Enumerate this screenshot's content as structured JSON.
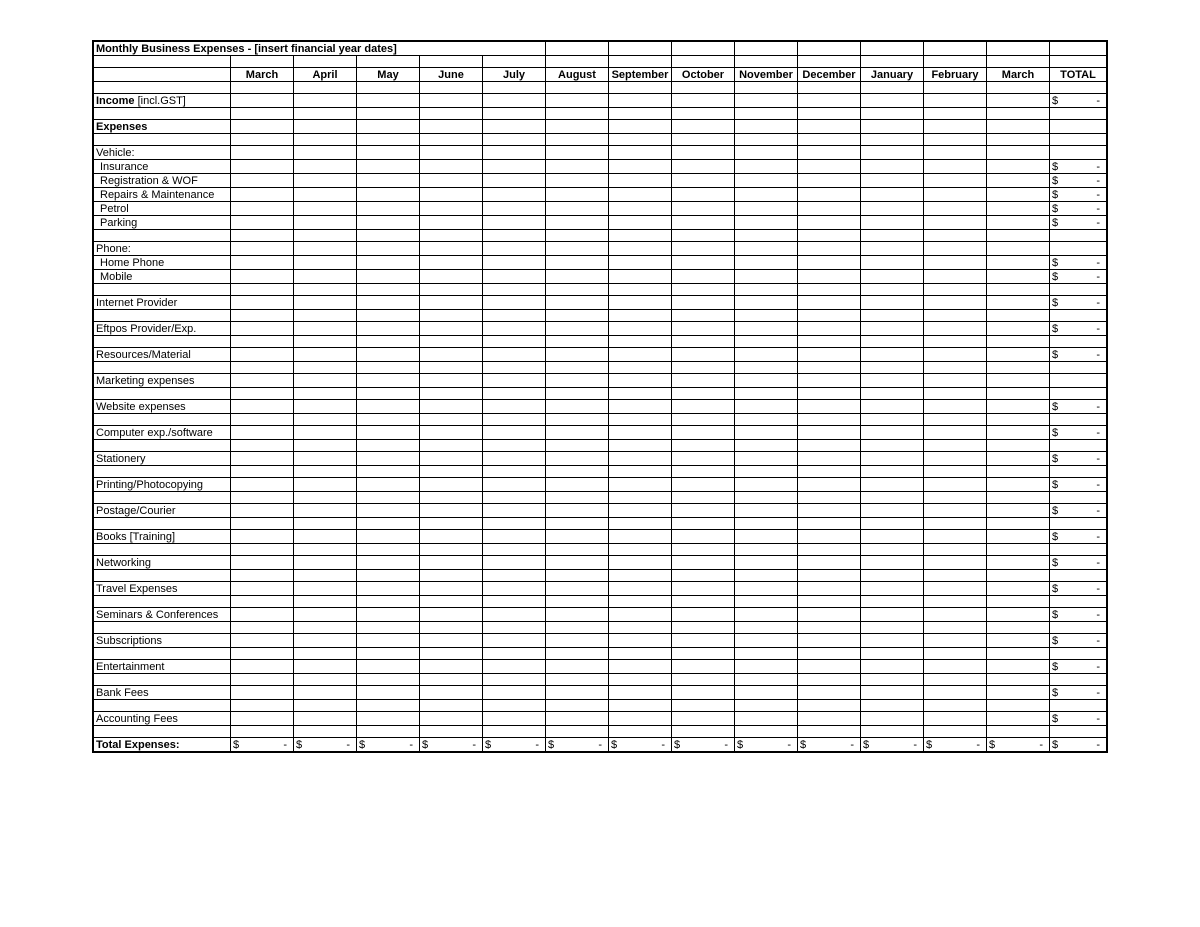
{
  "title": "Monthly Business Expenses - [insert financial year dates]",
  "months": [
    "March",
    "April",
    "May",
    "June",
    "July",
    "August",
    "September",
    "October",
    "November",
    "December",
    "January",
    "February",
    "March"
  ],
  "totalHeader": "TOTAL",
  "incomeLabelBold": "Income",
  "incomeLabelRest": " [incl.GST]",
  "expensesHeader": "Expenses",
  "currency": "$",
  "dash": "-",
  "totalsRowLabel": "Total Expenses:",
  "rows": [
    {
      "type": "spacer"
    },
    {
      "type": "category",
      "label": "Vehicle:"
    },
    {
      "type": "item",
      "label": "Insurance",
      "total": true
    },
    {
      "type": "item",
      "label": "Registration & WOF",
      "total": true
    },
    {
      "type": "item",
      "label": "Repairs & Maintenance",
      "total": true
    },
    {
      "type": "item",
      "label": "Petrol",
      "total": true
    },
    {
      "type": "item",
      "label": "Parking",
      "total": true
    },
    {
      "type": "spacer"
    },
    {
      "type": "category",
      "label": "Phone:"
    },
    {
      "type": "item",
      "label": "Home Phone",
      "total": true
    },
    {
      "type": "item",
      "label": "Mobile",
      "total": true
    },
    {
      "type": "spacer"
    },
    {
      "type": "category",
      "label": "Internet Provider",
      "total": true
    },
    {
      "type": "spacer"
    },
    {
      "type": "category",
      "label": "Eftpos Provider/Exp.",
      "total": true
    },
    {
      "type": "spacer"
    },
    {
      "type": "category",
      "label": "Resources/Material",
      "total": true
    },
    {
      "type": "spacer"
    },
    {
      "type": "category",
      "label": "Marketing expenses"
    },
    {
      "type": "spacer"
    },
    {
      "type": "category",
      "label": "Website expenses",
      "total": true
    },
    {
      "type": "spacer"
    },
    {
      "type": "category",
      "label": "Computer exp./software",
      "total": true
    },
    {
      "type": "spacer"
    },
    {
      "type": "category",
      "label": "Stationery",
      "total": true
    },
    {
      "type": "spacer"
    },
    {
      "type": "category",
      "label": "Printing/Photocopying",
      "total": true
    },
    {
      "type": "spacer"
    },
    {
      "type": "category",
      "label": "Postage/Courier",
      "total": true
    },
    {
      "type": "spacer"
    },
    {
      "type": "category",
      "label": "Books [Training]",
      "total": true
    },
    {
      "type": "spacer"
    },
    {
      "type": "category",
      "label": "Networking",
      "total": true
    },
    {
      "type": "spacer"
    },
    {
      "type": "category",
      "label": "Travel Expenses",
      "total": true
    },
    {
      "type": "spacer"
    },
    {
      "type": "category",
      "label": "Seminars & Conferences",
      "total": true
    },
    {
      "type": "spacer"
    },
    {
      "type": "category",
      "label": "Subscriptions",
      "total": true
    },
    {
      "type": "spacer"
    },
    {
      "type": "category",
      "label": "Entertainment",
      "total": true
    },
    {
      "type": "spacer"
    },
    {
      "type": "category",
      "label": "Bank Fees",
      "total": true
    },
    {
      "type": "spacer"
    },
    {
      "type": "category",
      "label": "Accounting Fees",
      "total": true
    },
    {
      "type": "spacer"
    }
  ]
}
